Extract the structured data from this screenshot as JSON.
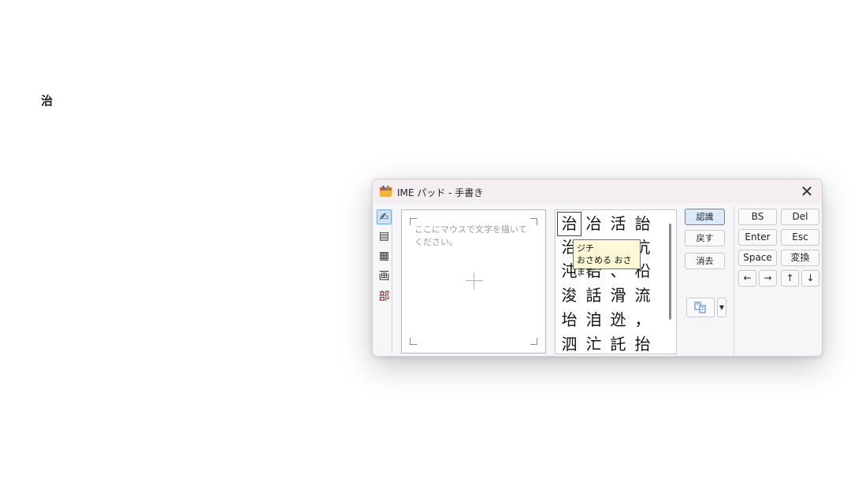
{
  "document": {
    "text": "治"
  },
  "ime_window": {
    "title": "IME パッド - 手書き",
    "close_label": "✕",
    "modes": [
      {
        "name": "handwriting",
        "glyph": "✍"
      },
      {
        "name": "character-list",
        "glyph": "▤"
      },
      {
        "name": "soft-keyboard",
        "glyph": "▦"
      },
      {
        "name": "stroke-count",
        "glyph": "画"
      },
      {
        "name": "radical",
        "glyph": "部"
      }
    ],
    "draw_hint": "ここにマウスで文字を描いてください。",
    "candidates": [
      [
        "治",
        "冶",
        "活",
        "詒"
      ],
      [
        "治",
        "治",
        "治",
        "沆"
      ],
      [
        "沌",
        "佁",
        "、",
        "柗"
      ],
      [
        "浚",
        "話",
        "滑",
        "流"
      ],
      [
        "坮",
        "洎",
        "迯",
        "，"
      ],
      [
        "泗",
        "汒",
        "託",
        "抬"
      ]
    ],
    "tooltip": {
      "reading_on": "ジチ",
      "reading_kun": "おさめる おさまる"
    },
    "actions": {
      "recognize": "認識",
      "undo": "戻す",
      "clear": "消去"
    },
    "keys": {
      "bs": "BS",
      "del": "Del",
      "enter": "Enter",
      "esc": "Esc",
      "space": "Space",
      "convert": "変換",
      "left": "←",
      "right": "→",
      "up": "↑",
      "down": "↓"
    },
    "colors": {
      "accent": "#4f8bd1",
      "tooltip_bg": "#fdf9d7"
    }
  }
}
